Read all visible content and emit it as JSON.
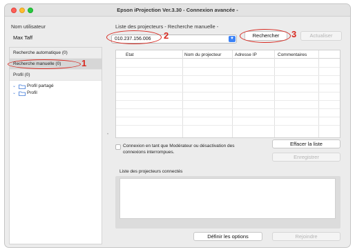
{
  "window": {
    "title": "Epson iProjection Ver.3.30 - Connexion avancée -"
  },
  "left": {
    "user_label": "Nom utilisateur",
    "user_value": "Max Taff",
    "items": [
      {
        "label": "Recherche automatique (0)"
      },
      {
        "label": "Recherche manuelle (0)"
      },
      {
        "label": "Profil (0)"
      }
    ],
    "tree": [
      {
        "label": "Profil partagé"
      },
      {
        "label": "Profil"
      }
    ]
  },
  "main": {
    "list_label": "Liste des projecteurs  - Recherche manuelle -",
    "ip_value": "010.237.156.006",
    "search_button": "Rechercher",
    "refresh_button": "Actualiser",
    "columns": [
      "Etat",
      "Nom du projecteur",
      "Adresse IP",
      "Commentaires"
    ],
    "checkbox_text_1": "Connexion en tant que Modérateur ou désactivation des",
    "checkbox_text_2": "connexions interrompues.",
    "clear_button": "Effacer la liste",
    "save_button": "Enregistrer",
    "connected_label": "Liste des projecteurs connectés",
    "options_button": "Définir les options",
    "join_button": "Rejoindre"
  },
  "annotations": [
    "1",
    "2",
    "3"
  ],
  "colors": {
    "annotation": "#d8281f",
    "accent": "#3b82f6"
  }
}
